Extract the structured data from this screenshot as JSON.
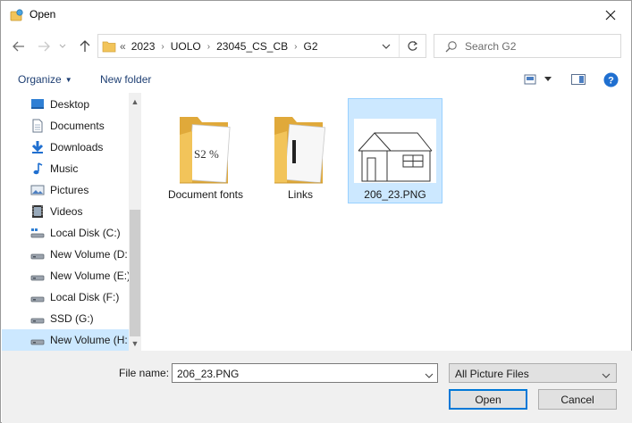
{
  "window": {
    "title": "Open"
  },
  "address": {
    "lead": "«",
    "crumbs": [
      "2023",
      "UOLO",
      "23045_CS_CB",
      "G2"
    ]
  },
  "search": {
    "placeholder": "Search G2"
  },
  "toolbar": {
    "organize_label": "Organize",
    "new_folder_label": "New folder"
  },
  "nav": {
    "items": [
      {
        "label": "Desktop",
        "icon": "desktop-icon"
      },
      {
        "label": "Documents",
        "icon": "documents-icon"
      },
      {
        "label": "Downloads",
        "icon": "downloads-icon"
      },
      {
        "label": "Music",
        "icon": "music-icon"
      },
      {
        "label": "Pictures",
        "icon": "pictures-icon"
      },
      {
        "label": "Videos",
        "icon": "videos-icon"
      },
      {
        "label": "Local Disk (C:)",
        "icon": "system-drive-icon"
      },
      {
        "label": "New Volume (D:",
        "icon": "drive-icon"
      },
      {
        "label": "New Volume (E:)",
        "icon": "drive-icon"
      },
      {
        "label": "Local Disk (F:)",
        "icon": "drive-icon"
      },
      {
        "label": "SSD (G:)",
        "icon": "drive-icon"
      },
      {
        "label": "New Volume (H:",
        "icon": "drive-icon"
      }
    ],
    "selected_index": 11
  },
  "files": [
    {
      "name": "Document fonts",
      "type": "folder",
      "icon": "folder-icon"
    },
    {
      "name": "Links",
      "type": "folder",
      "icon": "folder-icon"
    },
    {
      "name": "206_23.PNG",
      "type": "image",
      "icon": "house-drawing-thumbnail",
      "selected": true
    }
  ],
  "footer": {
    "file_name_label": "File name:",
    "file_name_value": "206_23.PNG",
    "filter_value": "All Picture Files",
    "open_label": "Open",
    "cancel_label": "Cancel"
  },
  "colors": {
    "accent": "#0078d7",
    "selection": "#cce8ff",
    "link": "#1e3f73",
    "folder": "#f2c45a"
  }
}
